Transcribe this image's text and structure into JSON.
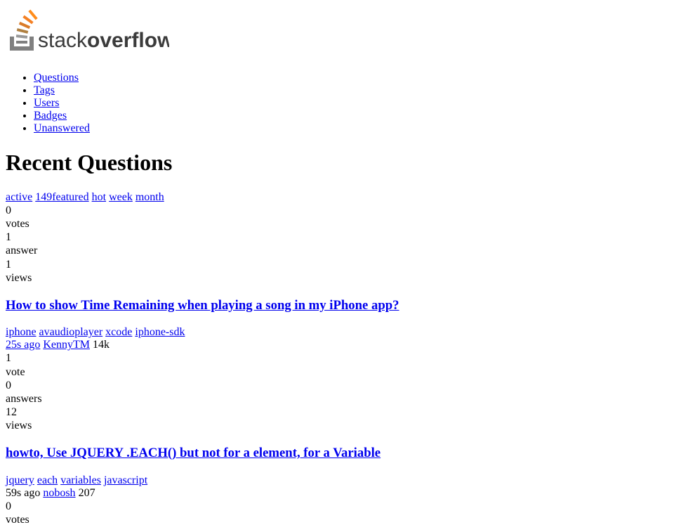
{
  "logo": {
    "text1": "stack",
    "text2": "overflow"
  },
  "nav": [
    "Questions",
    "Tags",
    "Users",
    "Badges",
    "Unanswered"
  ],
  "heading": "Recent Questions",
  "tabs": [
    {
      "label": "active"
    },
    {
      "label": "149featured"
    },
    {
      "label": "hot"
    },
    {
      "label": "week"
    },
    {
      "label": "month"
    }
  ],
  "questions": [
    {
      "votes_count": "0",
      "votes_label": "votes",
      "answers_count": "1",
      "answers_label": "answer",
      "views_count": "1",
      "views_label": "views",
      "title": "How to show Time Remaining when playing a song in my iPhone app?",
      "tags": [
        "iphone",
        "avaudioplayer",
        "xcode",
        "iphone-sdk"
      ],
      "time": "25s ago",
      "user": "KennyTM",
      "rep": "14k"
    },
    {
      "votes_count": "1",
      "votes_label": "vote",
      "answers_count": "0",
      "answers_label": "answers",
      "views_count": "12",
      "views_label": "views",
      "title": "howto, Use JQUERY .EACH() but not for a element, for a Variable",
      "tags": [
        "jquery",
        "each",
        "variables",
        "javascript"
      ],
      "time": "59s ago",
      "user": "nobosh",
      "rep": "207"
    },
    {
      "votes_count": "0",
      "votes_label": "votes",
      "answers_count": "",
      "answers_label": "",
      "views_count": "",
      "views_label": "",
      "title": "",
      "tags": [],
      "time": "",
      "user": "",
      "rep": ""
    }
  ]
}
